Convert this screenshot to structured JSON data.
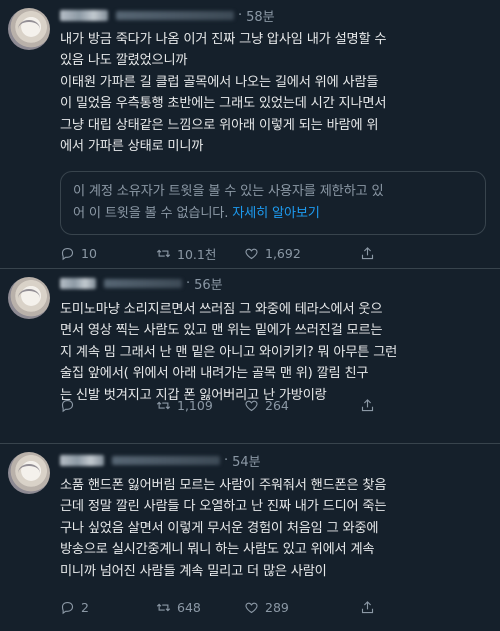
{
  "tweets": [
    {
      "time": "58분",
      "lines": [
        "내가 방금 죽다가 나옴 이거 진짜 그냥 압사임 내가 설명할 수",
        "있음 나도 깔렸었으니까",
        "이태원 가파른 길 클럽 골목에서 나오는 길에서 위에 사람들",
        "이 밀었음 우측통행 초반에는 그래도 있었는데 시간 지나면서",
        "그냥 대립 상태같은 느낌으로 위아래 이렇게 되는 바람에 위",
        "에서 가파른 상태로 미니까"
      ],
      "notice_line1": "이 계정 소유자가 트윗을 볼 수 있는 사용자를 제한하고 있",
      "notice_line2": "어 이 트윗을 볼 수 없습니다.",
      "notice_link": "자세히 알아보기",
      "replies": "10",
      "retweets": "10.1천",
      "likes": "1,692"
    },
    {
      "time": "56분",
      "lines": [
        "도미노마냥 소리지르면서 쓰러짐 그 와중에 테라스에서 웃으",
        "면서 영상 찍는 사람도 있고 맨 위는 밑에가 쓰러진걸 모르는",
        "지 계속 밈 그래서 난 맨 밑은 아니고 와이키키? 뭐 아무튼 그런",
        "술집 앞에서( 위에서 아래 내려가는 골목 맨 위) 깔림 친구",
        "는 신발 벗겨지고 지갑 폰 잃어버리고 난 가방이랑"
      ],
      "replies": "",
      "retweets": "1,109",
      "likes": "264"
    },
    {
      "time": "54분",
      "lines": [
        "소품 핸드폰 잃어버림 모르는 사람이 주워줘서 핸드폰은 찾음",
        "근데 정말 깔린 사람들 다 오열하고 난 진짜 내가 드디어 죽는",
        "구나 싶었음 살면서 이렇게 무서운 경험이 처음임 그 와중에",
        "방송으로 실시간중계니 뭐니 하는 사람도 있고 위에서 계속",
        "미니까 넘어진 사람들 계속 밀리고 더 많은 사람이"
      ],
      "replies": "2",
      "retweets": "648",
      "likes": "289"
    }
  ],
  "icons": {
    "reply": "reply-icon",
    "retweet": "retweet-icon",
    "like": "heart-icon",
    "share": "share-icon"
  },
  "colors": {
    "background": "#15202b",
    "text": "#e7e9ea",
    "muted": "#8b98a5",
    "link": "#1d9bf0",
    "border": "#38444d"
  }
}
